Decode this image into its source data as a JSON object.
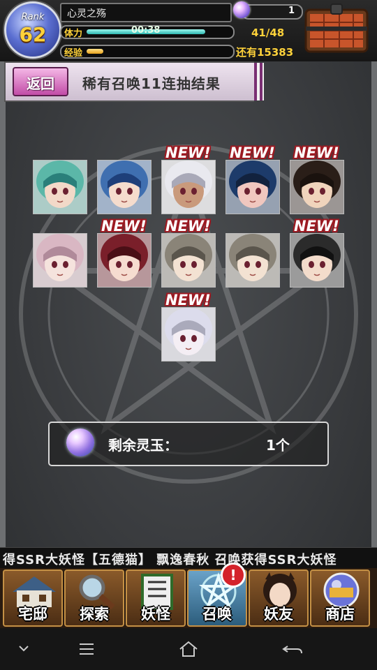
{
  "hud": {
    "rank_label": "Rank",
    "rank_value": "62",
    "player_name": "心灵之殇",
    "orb_count": "1",
    "stamina_label": "体力",
    "stamina_timer": "00:38",
    "stamina_value": "41/48",
    "stamina_fraction": 0.85,
    "exp_label": "经验",
    "exp_remaining": "还有15383",
    "exp_fraction": 0.12
  },
  "title_bar": {
    "back_label": "返回",
    "title": "稀有召唤11连抽结果"
  },
  "results": [
    {
      "new": false,
      "tag": ""
    },
    {
      "new": false,
      "tag": ""
    },
    {
      "new": true,
      "tag": "NEW!"
    },
    {
      "new": true,
      "tag": "NEW!"
    },
    {
      "new": true,
      "tag": "NEW!"
    },
    {
      "new": false,
      "tag": ""
    },
    {
      "new": true,
      "tag": "NEW!"
    },
    {
      "new": true,
      "tag": "NEW!"
    },
    {
      "new": false,
      "tag": ""
    },
    {
      "new": true,
      "tag": "NEW!"
    },
    {
      "new": true,
      "tag": "NEW!"
    }
  ],
  "remaining": {
    "label": "剩余灵玉：",
    "value": "1个"
  },
  "marquee": {
    "text": "得SSR大妖怪【五德猫】   飘逸春秋 召唤获得SSR大妖怪"
  },
  "nav": [
    {
      "label": "宅邸",
      "icon": "house-icon"
    },
    {
      "label": "探索",
      "icon": "magnifier-icon"
    },
    {
      "label": "妖怪",
      "icon": "scroll-icon"
    },
    {
      "label": "召唤",
      "icon": "pentagram-icon"
    },
    {
      "label": "妖友",
      "icon": "friend-icon"
    },
    {
      "label": "商店",
      "icon": "orb-shop-icon"
    }
  ],
  "nav_badge": "!",
  "colors": {
    "stamina": "#2db6b0",
    "exp": "#e8a21c",
    "new_tag_outline": "#9c1a22",
    "accent_gold": "#ffd23a",
    "back_button": "#c24ca7"
  }
}
